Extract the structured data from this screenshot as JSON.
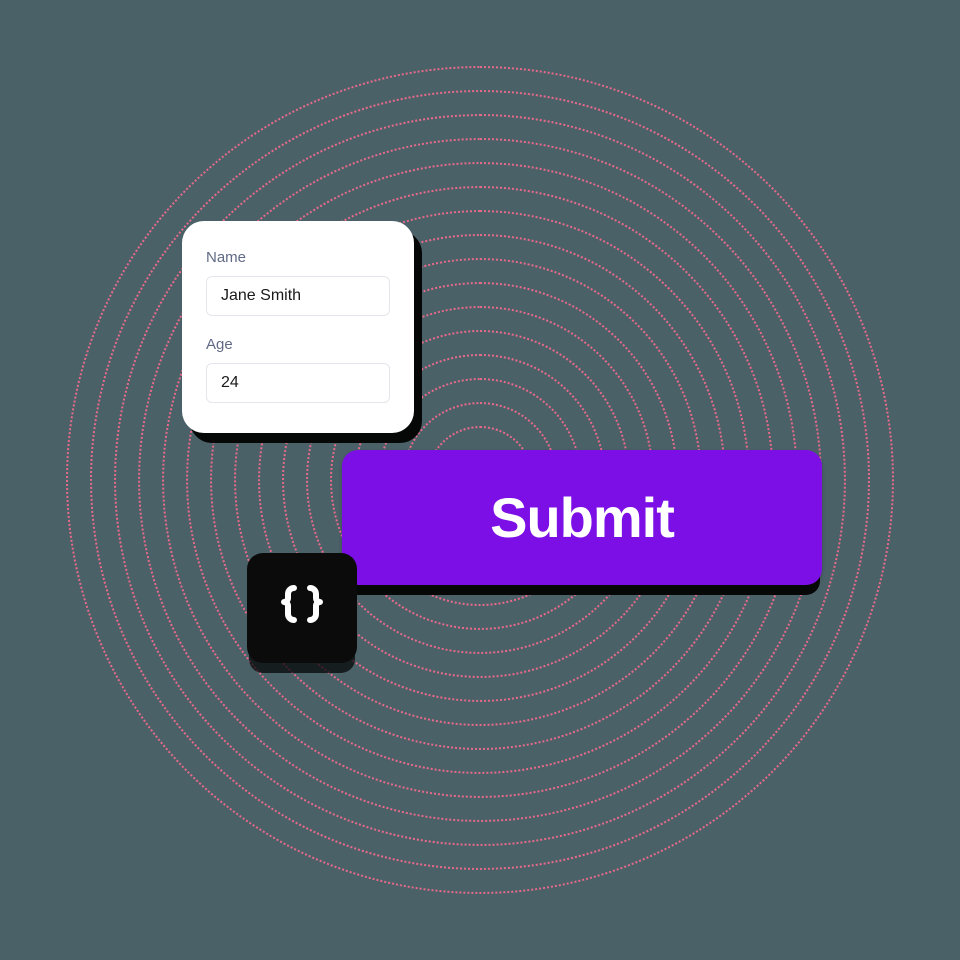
{
  "form": {
    "name_label": "Name",
    "name_value": "Jane Smith",
    "age_label": "Age",
    "age_value": "24"
  },
  "submit": {
    "label": "Submit"
  },
  "colors": {
    "ring": "#e86a8a",
    "button": "#7c0fe6",
    "shadow": "#060707",
    "card_bg": "#ffffff",
    "page_bg": "#4b6168",
    "tile_bg": "#0b0b0b"
  }
}
